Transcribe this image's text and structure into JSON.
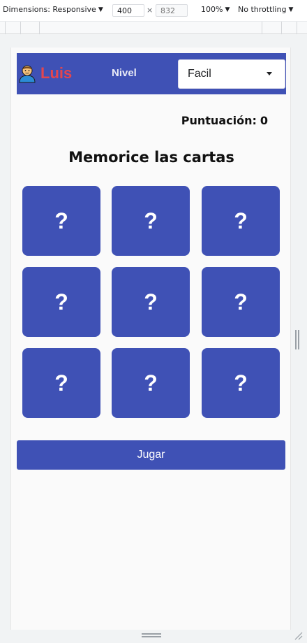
{
  "devtools": {
    "dimensions_label": "Dimensions: Responsive",
    "width_value": "400",
    "height_placeholder": "832",
    "x_sep": "×",
    "zoom": "100%",
    "throttling": "No throttling"
  },
  "app": {
    "user_name": "Luis",
    "nivel_label": "Nivel",
    "level_selected": "Facil",
    "score_label": "Puntuación:",
    "score_value": "0",
    "heading": "Memorice las cartas",
    "cards": [
      "?",
      "?",
      "?",
      "?",
      "?",
      "?",
      "?",
      "?",
      "?"
    ],
    "play_button": "Jugar"
  },
  "colors": {
    "primary": "#3f51b5",
    "user_name": "#e2464f",
    "page_bg": "#fafafa"
  },
  "icons": {
    "avatar": "person-avatar-icon",
    "dropdown": "caret-down-icon",
    "resize": "resize-handle-icon"
  }
}
